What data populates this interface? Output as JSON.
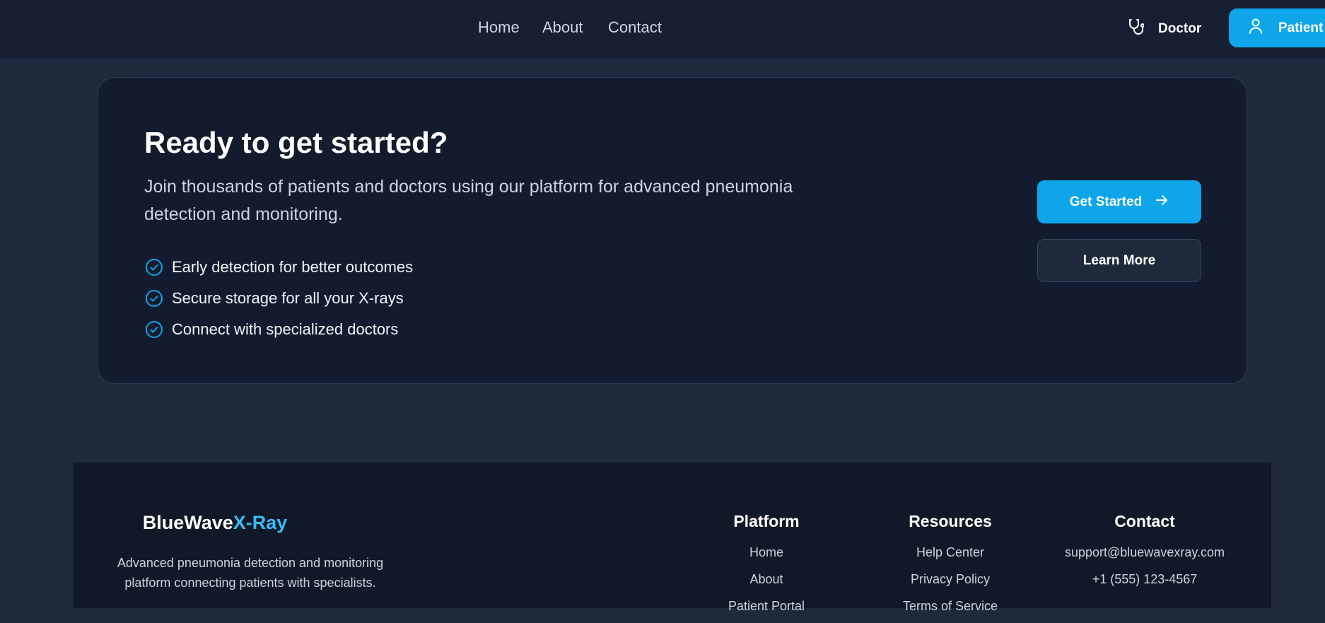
{
  "nav": {
    "links": [
      "Home",
      "About",
      "Contact"
    ],
    "doctor_label": "Doctor",
    "patient_label": "Patient"
  },
  "cta": {
    "title": "Ready to get started?",
    "description": "Join thousands of patients and doctors using our platform for advanced pneumonia detection and monitoring.",
    "benefits": [
      "Early detection for better outcomes",
      "Secure storage for all your X-rays",
      "Connect with specialized doctors"
    ],
    "primary_button": "Get Started",
    "secondary_button": "Learn More"
  },
  "footer": {
    "brand_part1": "BlueWave",
    "brand_part2": "X-Ray",
    "tagline": "Advanced pneumonia detection and monitoring platform connecting patients with specialists.",
    "platform": {
      "heading": "Platform",
      "links": [
        "Home",
        "About",
        "Patient Portal"
      ]
    },
    "resources": {
      "heading": "Resources",
      "links": [
        "Help Center",
        "Privacy Policy",
        "Terms of Service"
      ]
    },
    "contact": {
      "heading": "Contact",
      "items": [
        "support@bluewavexray.com",
        "+1 (555) 123-4567"
      ]
    }
  },
  "colors": {
    "accent": "#0ea5e9",
    "brand_highlight": "#38bdf8",
    "background": "#1e293b",
    "card": "#131c2e"
  }
}
